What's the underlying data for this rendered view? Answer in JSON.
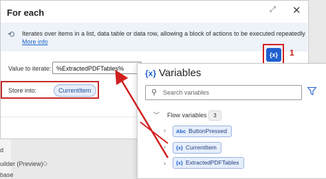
{
  "dialog": {
    "title": "For each",
    "expand_icon": "expand-icon",
    "close_icon": "close-icon",
    "info_text": "Iterates over items in a list, data table or data row, allowing a block of actions to be executed repeatedly",
    "more_info": "More info",
    "value_label": "Value to iterate:",
    "value": "%ExtractedPDFTables%",
    "store_label": "Store into:",
    "store_value": "CurrentItem",
    "variables_button": "{x}"
  },
  "annotation": {
    "step_number": "1",
    "color": "#d11f1f"
  },
  "background": {
    "items": [
      "d",
      "uilder (Preview)",
      "base"
    ]
  },
  "variables_panel": {
    "icon": "{x}",
    "title": "Variables",
    "search_placeholder": "Search variables",
    "section_label": "Flow variables",
    "section_count": "3",
    "items": [
      {
        "icon": "text-variable-icon",
        "icon_glyph": "Abc",
        "label": "ButtonPressed"
      },
      {
        "icon": "variable-icon",
        "icon_glyph": "{x}",
        "label": "CurrentItem"
      },
      {
        "icon": "variable-icon",
        "icon_glyph": "{x}",
        "label": "ExtractedPDFTables"
      }
    ]
  },
  "colors": {
    "accent": "#1f5fcf",
    "annotation_red": "#d11f1f",
    "chip_bg": "#e6eefb"
  }
}
